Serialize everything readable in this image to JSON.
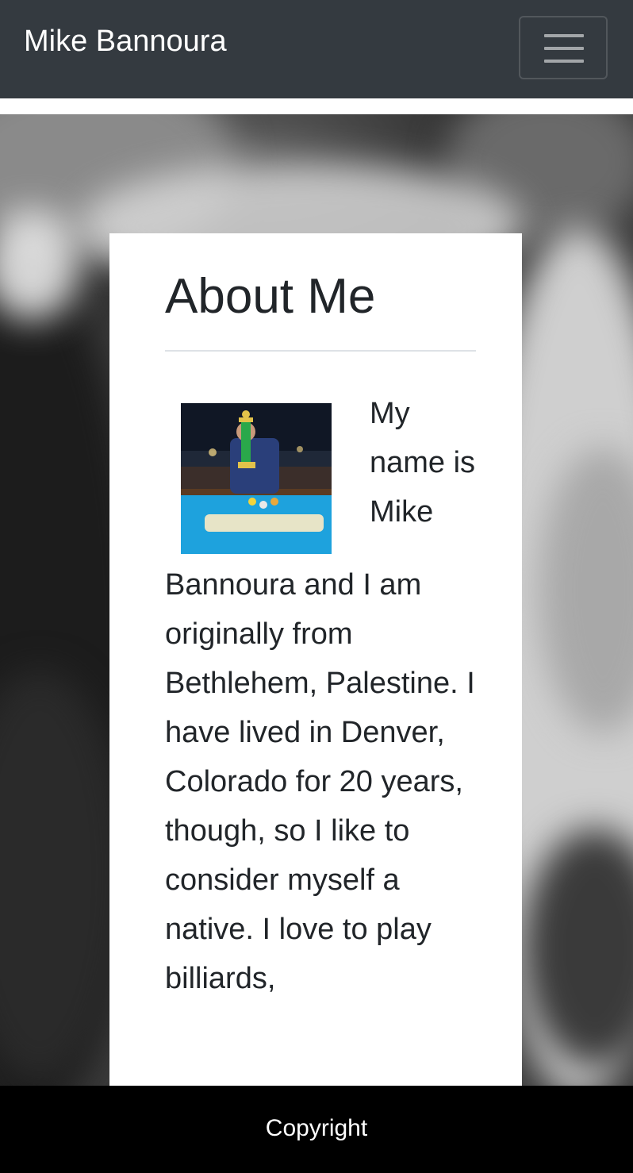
{
  "navbar": {
    "brand": "Mike Bannoura",
    "toggler_icon": "hamburger-menu-icon"
  },
  "about": {
    "title": "About Me",
    "body": "My name is Mike Bannoura and I am originally from Bethlehem, Palestine. I have lived in Denver, Colorado for 20 years, though, so I like to consider myself a native. I love to play billiards,",
    "photo": "profile-photo-with-billiards-trophy"
  },
  "footer": {
    "text": "Copyright"
  },
  "colors": {
    "navbar_bg": "#343a40",
    "footer_bg": "#000000",
    "card_bg": "#ffffff",
    "text": "#212529"
  }
}
